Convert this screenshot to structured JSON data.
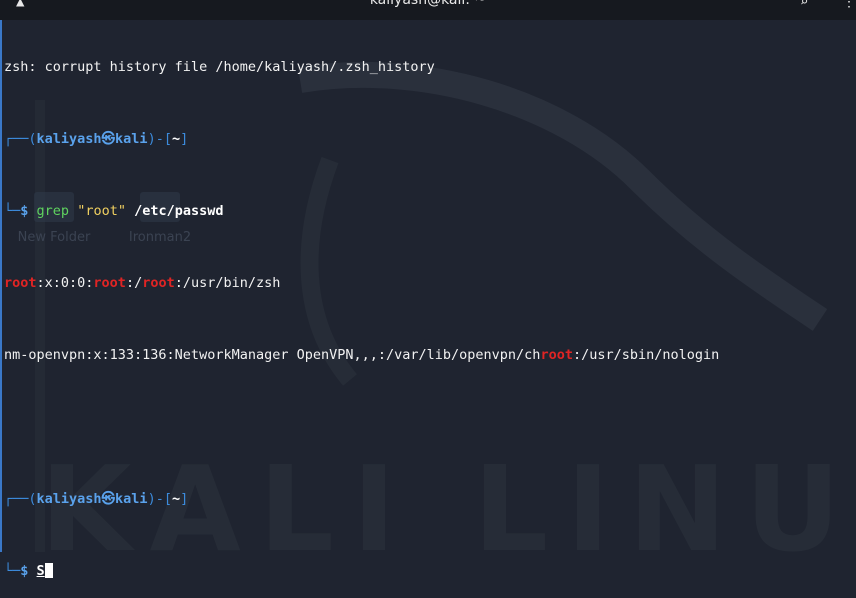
{
  "window": {
    "title": "kaliyash@kali: ~"
  },
  "desktop": {
    "icons": [
      {
        "label": "New Folder"
      },
      {
        "label": "Ironman2"
      }
    ],
    "wallpaper_text": "KALI LINUX"
  },
  "terminal": {
    "warning": "zsh: corrupt history file /home/kaliyash/.zsh_history",
    "prompt1": {
      "corner_top": "┌──(",
      "user": "kaliyash",
      "at": "㉿",
      "host": "kali",
      "sep": ")-[",
      "dir": "~",
      "close": "]",
      "corner_bottom": "└─",
      "symbol": "$",
      "cmd": "grep",
      "arg_str": "\"root\"",
      "arg_path": "/etc/passwd"
    },
    "output1": {
      "p1": "root",
      "p2": ":x:0:0:",
      "p3": "root",
      "p4": ":/",
      "p5": "root",
      "p6": ":/usr/bin/zsh"
    },
    "output2": {
      "p1": "nm-openvpn:x:133:136:NetworkManager OpenVPN,,,:/var/lib/openvpn/ch",
      "p2": "root",
      "p3": ":/usr/sbin/nologin"
    },
    "prompt2": {
      "corner_top": "┌──(",
      "user": "kaliyash",
      "at": "㉿",
      "host": "kali",
      "sep": ")-[",
      "dir": "~",
      "close": "]",
      "corner_bottom": "└─",
      "symbol": "$",
      "input": "S"
    }
  },
  "colors": {
    "background": "#1f2430",
    "prompt_blue": "#3c8bdc",
    "match_red": "#e02424",
    "command_green": "#5fd35f",
    "string_yellow": "#f0d060"
  }
}
